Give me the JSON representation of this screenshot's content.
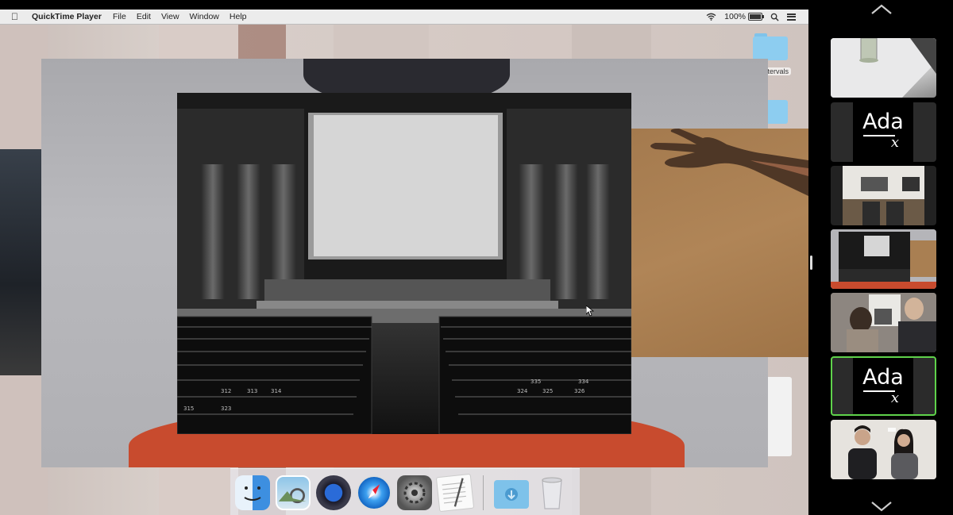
{
  "menubar": {
    "apple_icon": "apple-icon",
    "app_name": "QuickTime Player",
    "menus": [
      "File",
      "Edit",
      "View",
      "Window",
      "Help"
    ],
    "battery": "100%",
    "status_icons": [
      "wifi-icon",
      "battery-icon",
      "spotlight-search-icon",
      "notification-center-icon"
    ]
  },
  "desktop": {
    "folders": [
      {
        "label": "...tervals"
      },
      {
        "label": ""
      }
    ]
  },
  "cinema_photo": {
    "seat_labels": [
      "312",
      "313",
      "314",
      "323",
      "315",
      "326",
      "325",
      "324",
      "335",
      "334"
    ]
  },
  "dock": {
    "items": [
      "finder-icon",
      "preview-icon",
      "quicktime-icon",
      "safari-icon",
      "system-preferences-icon",
      "textedit-icon",
      "downloads-folder-icon",
      "trash-icon"
    ]
  },
  "sidebar": {
    "scroll_up": "chevron-up-icon",
    "scroll_down": "chevron-down-icon",
    "ada_word": "Ada",
    "ada_sub": "x",
    "participants": [
      {
        "kind": "video",
        "desc": "table-glass-video"
      },
      {
        "kind": "logo"
      },
      {
        "kind": "video",
        "desc": "desk-overhead-video"
      },
      {
        "kind": "video",
        "desc": "cinema-share-video"
      },
      {
        "kind": "video",
        "desc": "two-people-at-computer-video"
      },
      {
        "kind": "logo",
        "active": true
      },
      {
        "kind": "video",
        "desc": "two-people-portrait-video"
      }
    ],
    "active_color": "#5fd24b"
  }
}
